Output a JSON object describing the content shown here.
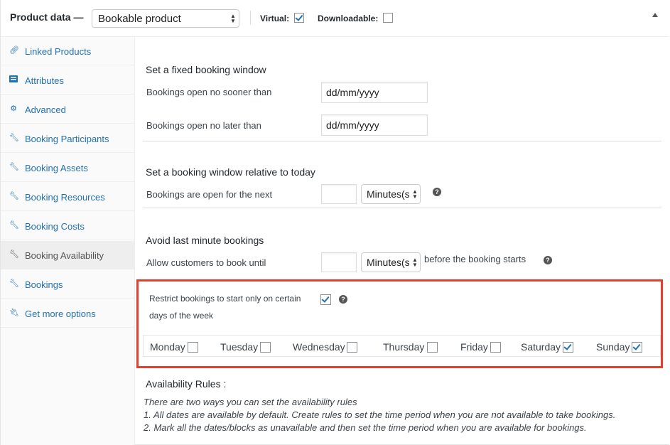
{
  "header": {
    "title": "Product data —",
    "product_type": "Bookable product",
    "virtual_label": "Virtual:",
    "virtual_checked": true,
    "downloadable_label": "Downloadable:",
    "downloadable_checked": false
  },
  "sidebar": {
    "items": [
      {
        "label": "Linked Products",
        "icon": "link-icon"
      },
      {
        "label": "Attributes",
        "icon": "list-icon"
      },
      {
        "label": "Advanced",
        "icon": "gear-icon"
      },
      {
        "label": "Booking Participants",
        "icon": "wrench-icon"
      },
      {
        "label": "Booking Assets",
        "icon": "wrench-icon"
      },
      {
        "label": "Booking Resources",
        "icon": "wrench-icon"
      },
      {
        "label": "Booking Costs",
        "icon": "wrench-icon"
      },
      {
        "label": "Booking Availability",
        "icon": "wrench-icon",
        "active": true
      },
      {
        "label": "Bookings",
        "icon": "wrench-icon"
      },
      {
        "label": "Get more options",
        "icon": "plug-icon"
      }
    ]
  },
  "fixed_window": {
    "heading": "Set a fixed booking window",
    "open_no_sooner_label": "Bookings open no sooner than",
    "open_no_sooner_placeholder": "dd/mm/yyyy",
    "open_no_later_label": "Bookings open no later than",
    "open_no_later_placeholder": "dd/mm/yyyy"
  },
  "relative_window": {
    "heading": "Set a booking window relative to today",
    "open_for_next_label": "Bookings are open for the next",
    "unit": "Minutes(s)"
  },
  "last_minute": {
    "heading": "Avoid last minute bookings",
    "allow_until_label": "Allow customers to book until",
    "unit": "Minutes(s)",
    "suffix": "before the booking starts"
  },
  "restrict": {
    "label_line1": "Restrict bookings to start only on certain",
    "label_line2": "days of the week",
    "checked": true,
    "days": [
      {
        "label": "Monday",
        "checked": false
      },
      {
        "label": "Tuesday",
        "checked": false
      },
      {
        "label": "Wednesday",
        "checked": false
      },
      {
        "label": "Thursday",
        "checked": false
      },
      {
        "label": "Friday",
        "checked": false
      },
      {
        "label": "Saturday",
        "checked": true
      },
      {
        "label": "Sunday",
        "checked": true
      }
    ]
  },
  "availability": {
    "title": "Availability Rules :",
    "note_line1": "There are two ways you can set the availability rules",
    "note_line2": "1. All dates are available by default. Create rules to set the time period when you are not available to take bookings.",
    "note_line3": "2. Mark all the dates/blocks as unavailable and then set the time period when you are available for bookings."
  },
  "colors": {
    "accent": "#2271b1",
    "highlight_border": "#e0402d"
  }
}
